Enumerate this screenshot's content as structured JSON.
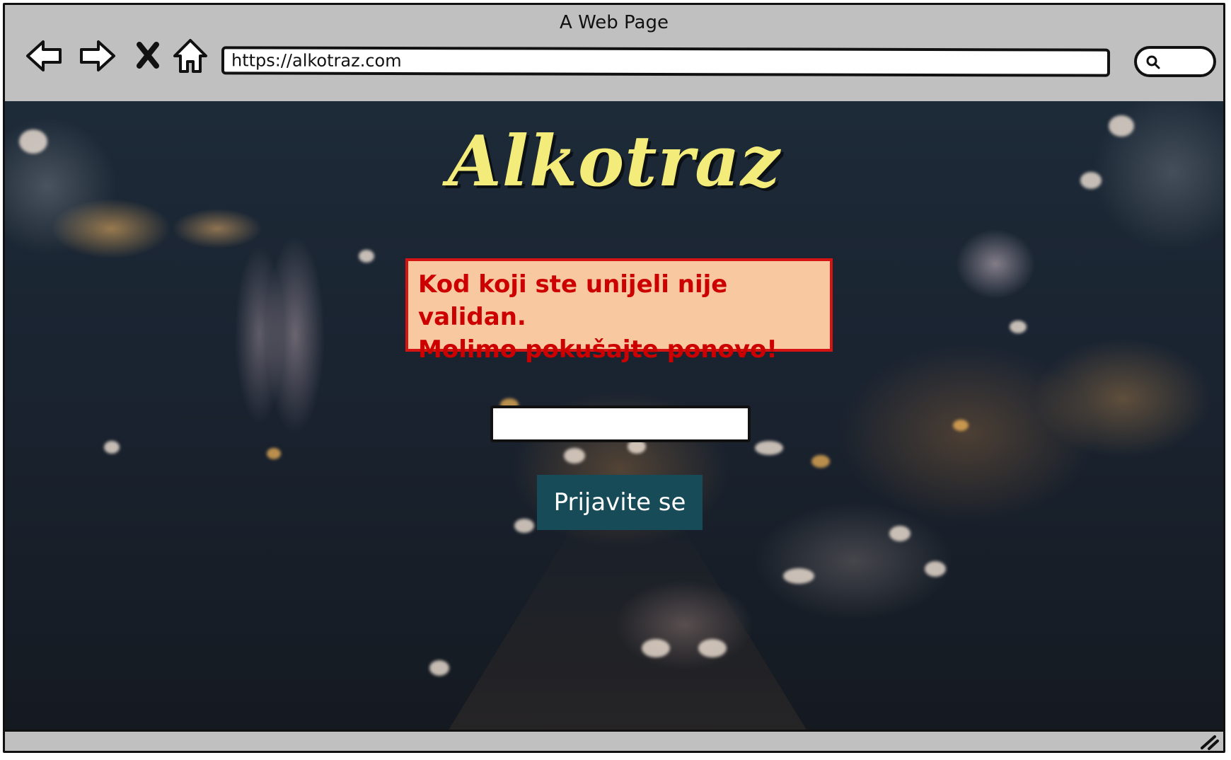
{
  "window": {
    "title": "A Web Page"
  },
  "toolbar": {
    "back_icon": "arrow-left-icon",
    "forward_icon": "arrow-right-icon",
    "stop_icon": "close-icon",
    "home_icon": "home-icon",
    "url": "https://alkotraz.com",
    "search_icon": "search-icon"
  },
  "page": {
    "logo_text": "Alkotraz",
    "error_line1": "Kod koji ste unijeli nije validan.",
    "error_line2": "Molimo pokušajte ponovo!",
    "code_value": "",
    "login_label": "Prijavite se",
    "colors": {
      "logo": "#f4ec7a",
      "error_text": "#cc0000",
      "error_bg": "#f8c9a0",
      "button_bg": "#174b57"
    }
  }
}
